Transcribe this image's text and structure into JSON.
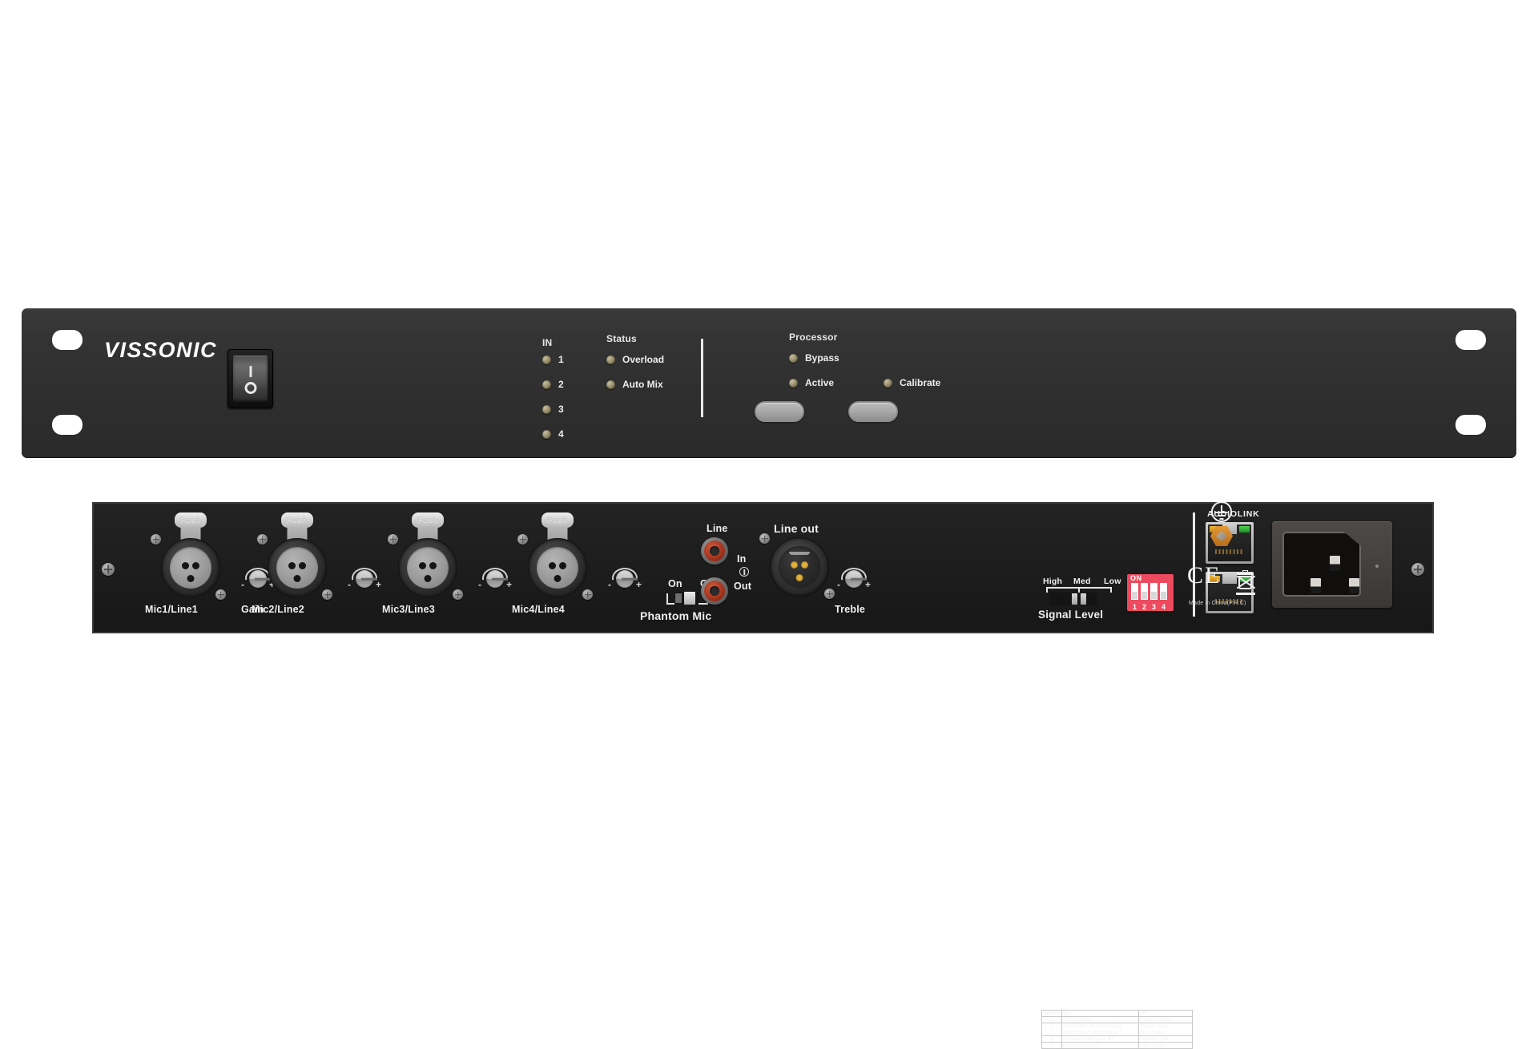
{
  "product": {
    "brand": "VISSONIC",
    "type": "rack-mount audio processor / automatic mixer, front and rear panel view"
  },
  "front_panel": {
    "power_switch": {
      "name": "power-rocker-switch",
      "on_symbol": "I",
      "off_symbol": "O",
      "state": "off"
    },
    "in_group": {
      "heading": "IN",
      "leds": [
        {
          "label": "1",
          "color": "#9a8f6f",
          "lit": false
        },
        {
          "label": "2",
          "color": "#9a8f6f",
          "lit": false
        },
        {
          "label": "3",
          "color": "#9a8f6f",
          "lit": false
        },
        {
          "label": "4",
          "color": "#9a8f6f",
          "lit": false
        }
      ]
    },
    "status_group": {
      "heading": "Status",
      "leds": [
        {
          "label": "Overload",
          "color": "#9a8f6f",
          "lit": false
        },
        {
          "label": "Auto Mix",
          "color": "#9a8f6f",
          "lit": false
        }
      ]
    },
    "processor_group": {
      "heading": "Processor",
      "leds": [
        {
          "label": "Bypass",
          "color": "#9a8f6f",
          "lit": false
        },
        {
          "label": "Active",
          "color": "#9a8f6f",
          "lit": false
        },
        {
          "label": "Calibrate",
          "color": "#9a8f6f",
          "lit": false
        }
      ],
      "buttons": [
        {
          "name": "processor-button-left",
          "label": ""
        },
        {
          "name": "processor-button-right",
          "label": ""
        }
      ]
    },
    "accent_colors": {
      "panel": "#2f2f2f",
      "text": "#eeeeee",
      "led": "#9a8f6f",
      "button": "#b0b0b0"
    }
  },
  "rear_panel": {
    "inputs": [
      {
        "label": "Mic1/Line1",
        "connector": "xlr-female-3pin",
        "push_text": "Push"
      },
      {
        "label": "Mic2/Line2",
        "connector": "xlr-female-3pin",
        "push_text": "Push"
      },
      {
        "label": "Mic3/Line3",
        "connector": "xlr-female-3pin",
        "push_text": "Push"
      },
      {
        "label": "Mic4/Line4",
        "connector": "xlr-female-3pin",
        "push_text": "Push"
      }
    ],
    "gain_label": "Gain",
    "pot_minus": "-",
    "pot_plus": "+",
    "phantom": {
      "label": "Phantom Mic",
      "on": "On",
      "off": "Off",
      "state": "Off"
    },
    "line_rca": {
      "group_label": "Line",
      "in_label": "In",
      "out_label": "Out"
    },
    "line_out_xlr": {
      "label": "Line out",
      "connector": "xlr-male-3pin"
    },
    "treble_label": "Treble",
    "switch_table": {
      "headers": [
        "Switch",
        "On",
        "Off"
      ],
      "rows": [
        {
          "num": "1",
          "on": [
            "Music mode"
          ],
          "off": [
            "Speech mode"
          ]
        },
        {
          "num": "2",
          "on": [
            "Four input voice tracking",
            "Mic1+Mic2+Mic3+Mic4"
          ],
          "off": [
            "Single input",
            "Mic1+Mic2"
          ]
        },
        {
          "num": "3",
          "on": [
            "Process with bass lift"
          ],
          "off": [
            "Process flat"
          ]
        },
        {
          "num": "4",
          "on": [
            "Accurate mode"
          ],
          "off": [
            "Fast mode"
          ]
        }
      ]
    },
    "signal_level": {
      "label": "Signal Level",
      "options": [
        "High",
        "Med",
        "Low"
      ],
      "selected": "Med"
    },
    "dip_switch": {
      "on_label": "ON",
      "numbers": [
        "1",
        "2",
        "3",
        "4"
      ],
      "body_color": "#ec4a5e"
    },
    "audiolink": {
      "label": "AUDIOLINK",
      "ports": [
        {
          "name": "audiolink-port-1",
          "type": "rj45"
        },
        {
          "name": "audiolink-port-2",
          "type": "rj45"
        }
      ]
    },
    "certification": {
      "ce_mark": "CE",
      "weee_symbol": "crossed-out-wheelie-bin",
      "ground_symbol": "protective-earth",
      "made_in": "Made in China(P.R.C)"
    },
    "power_inlet": {
      "name": "iec-c14-power-inlet",
      "type": "IEC 60320 C14"
    }
  }
}
